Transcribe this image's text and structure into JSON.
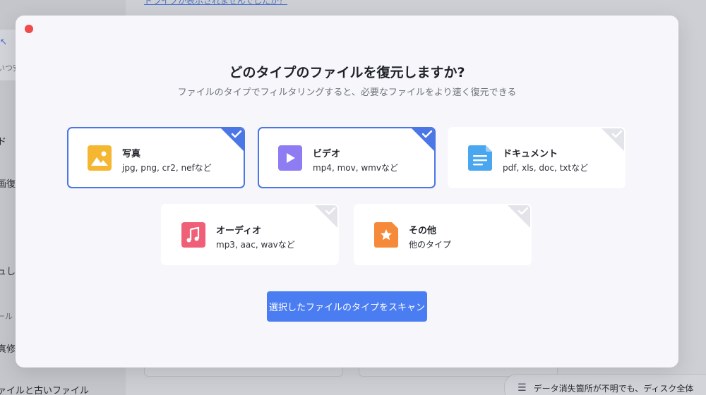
{
  "background": {
    "top_link": "ドライブが表示されませんでしたか？",
    "sidebar": {
      "fragment_1": "いつ安",
      "fragment_2": "ド",
      "fragment_3": "画復",
      "fragment_4": "ュし",
      "fragment_5": "ール",
      "fragment_6": "真修",
      "fragment_7": "ァイルと古いファイル"
    },
    "banner_text": "データ消失箇所が不明でも、ディスク全体"
  },
  "modal": {
    "title": "どのタイプのファイルを復元しますか?",
    "subtitle": "ファイルのタイプでフィルタリングすると、必要なファイルをより速く復元できる",
    "cards": [
      {
        "name": "写真",
        "desc": "jpg, png, cr2, nefなど",
        "selected": true,
        "icon": "photo-icon",
        "color": "#f5b731"
      },
      {
        "name": "ビデオ",
        "desc": "mp4, mov, wmvなど",
        "selected": true,
        "icon": "video-icon",
        "color": "#8d7cf2"
      },
      {
        "name": "ドキュメント",
        "desc": "pdf, xls, doc, txtなど",
        "selected": false,
        "icon": "document-icon",
        "color": "#4aa6ef"
      },
      {
        "name": "オーディオ",
        "desc": "mp3, aac, wavなど",
        "selected": false,
        "icon": "audio-icon",
        "color": "#ef5f78"
      },
      {
        "name": "その他",
        "desc": "他のタイプ",
        "selected": false,
        "icon": "other-star-icon",
        "color": "#f58a3a"
      }
    ],
    "scan_button": "選択したファイルのタイプをスキャン"
  },
  "colors": {
    "accent": "#4a76e6",
    "button": "#4a7cf2",
    "close": "#ef4b4b",
    "unselected_corner": "#e3e4ea"
  }
}
